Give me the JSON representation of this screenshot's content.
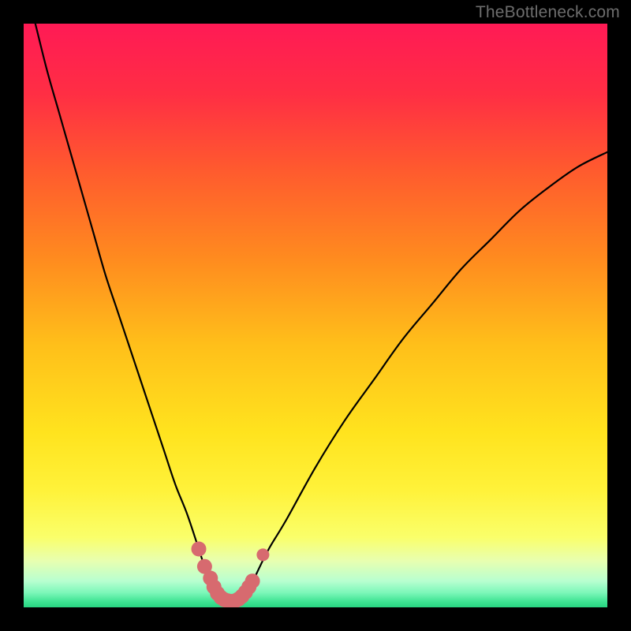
{
  "watermark": {
    "text": "TheBottleneck.com"
  },
  "chart_data": {
    "type": "line",
    "title": "",
    "xlabel": "",
    "ylabel": "",
    "xlim": [
      0,
      100
    ],
    "ylim": [
      0,
      100
    ],
    "grid": false,
    "series": [
      {
        "name": "curve",
        "x": [
          0,
          2,
          4,
          6,
          8,
          10,
          12,
          14,
          16,
          18,
          20,
          22,
          24,
          26,
          28,
          30,
          31,
          32,
          33,
          34,
          35,
          36,
          37,
          38,
          39,
          40,
          42,
          45,
          50,
          55,
          60,
          65,
          70,
          75,
          80,
          85,
          90,
          95,
          100
        ],
        "y": [
          108,
          100,
          92,
          85,
          78,
          71,
          64,
          57,
          51,
          45,
          39,
          33,
          27,
          21,
          16,
          10,
          7,
          5,
          3,
          1.5,
          1,
          1,
          1.3,
          2.2,
          3.8,
          6,
          10,
          15,
          24,
          32,
          39,
          46,
          52,
          58,
          63,
          68,
          72,
          75.5,
          78
        ]
      }
    ],
    "markers": {
      "name": "highlight-segment",
      "color": "#d76a6f",
      "points": [
        {
          "x": 30.0,
          "y": 10.0
        },
        {
          "x": 31.0,
          "y": 7.0
        },
        {
          "x": 32.0,
          "y": 5.0
        },
        {
          "x": 32.6,
          "y": 3.5
        },
        {
          "x": 33.2,
          "y": 2.4
        },
        {
          "x": 33.8,
          "y": 1.7
        },
        {
          "x": 34.4,
          "y": 1.3
        },
        {
          "x": 35.0,
          "y": 1.1
        },
        {
          "x": 35.6,
          "y": 1.0
        },
        {
          "x": 36.2,
          "y": 1.1
        },
        {
          "x": 36.8,
          "y": 1.4
        },
        {
          "x": 37.4,
          "y": 1.9
        },
        {
          "x": 38.0,
          "y": 2.6
        },
        {
          "x": 38.6,
          "y": 3.5
        },
        {
          "x": 39.2,
          "y": 4.5
        }
      ],
      "extra_point": {
        "x": 41.0,
        "y": 9.0
      }
    },
    "gradient_stops": [
      {
        "offset": 0.0,
        "color": "#ff1a55"
      },
      {
        "offset": 0.12,
        "color": "#ff2e44"
      },
      {
        "offset": 0.25,
        "color": "#ff5a2e"
      },
      {
        "offset": 0.4,
        "color": "#ff8a1f"
      },
      {
        "offset": 0.55,
        "color": "#ffbf1a"
      },
      {
        "offset": 0.7,
        "color": "#ffe31e"
      },
      {
        "offset": 0.8,
        "color": "#fff23a"
      },
      {
        "offset": 0.88,
        "color": "#faff6a"
      },
      {
        "offset": 0.92,
        "color": "#e8ffb0"
      },
      {
        "offset": 0.955,
        "color": "#b8ffd0"
      },
      {
        "offset": 0.975,
        "color": "#7cf7b9"
      },
      {
        "offset": 0.99,
        "color": "#3fe493"
      },
      {
        "offset": 1.0,
        "color": "#28d481"
      }
    ]
  }
}
